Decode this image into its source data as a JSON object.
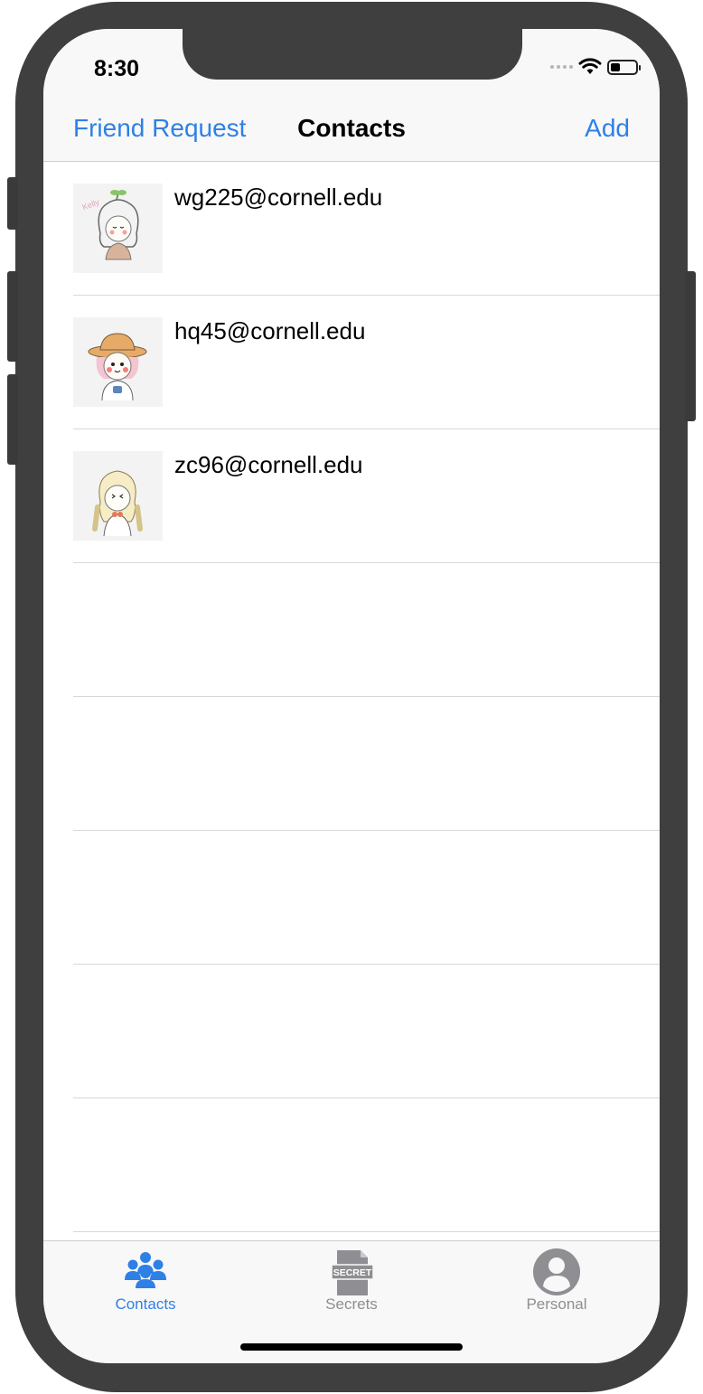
{
  "status_bar": {
    "time": "8:30"
  },
  "nav": {
    "left_button": "Friend Request",
    "title": "Contacts",
    "right_button": "Add"
  },
  "contacts": [
    {
      "email": "wg225@cornell.edu",
      "avatar": "girl-sprout-avatar"
    },
    {
      "email": "hq45@cornell.edu",
      "avatar": "girl-hat-avatar"
    },
    {
      "email": "zc96@cornell.edu",
      "avatar": "girl-braids-avatar"
    }
  ],
  "tabs": [
    {
      "label": "Contacts",
      "icon": "contacts-group-icon",
      "active": true
    },
    {
      "label": "Secrets",
      "icon": "secret-document-icon",
      "badge_text": "SECRET",
      "active": false
    },
    {
      "label": "Personal",
      "icon": "person-circle-icon",
      "active": false
    }
  ],
  "colors": {
    "accent": "#2f80e5",
    "inactive": "#8e8e93",
    "navbar_bg": "#f8f8f8"
  }
}
